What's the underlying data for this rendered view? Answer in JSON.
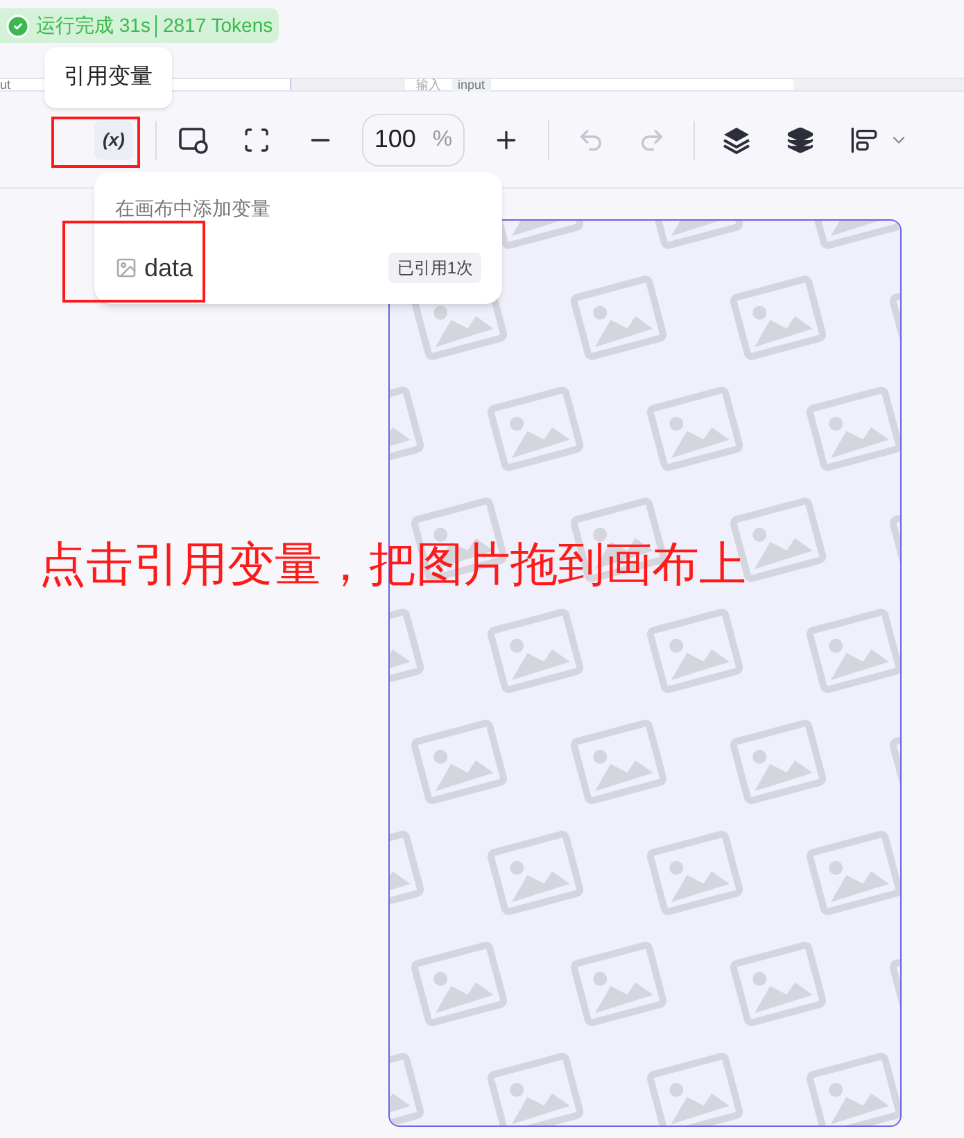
{
  "run_status": {
    "status": "运行完成 31s",
    "tokens": "2817 Tokens"
  },
  "node_strip": [
    "ut",
    "输入",
    "input"
  ],
  "tooltip": "引用变量",
  "toolbar": {
    "variable_button": "(x)",
    "zoom": {
      "value": "100",
      "unit": "%"
    },
    "undo_disabled": true,
    "redo_disabled": true
  },
  "popover": {
    "title": "在画布中添加变量",
    "items": [
      {
        "name": "data",
        "badge": "已引用1次"
      }
    ]
  },
  "annotation": "点击引用变量，把图片拖到画布上"
}
